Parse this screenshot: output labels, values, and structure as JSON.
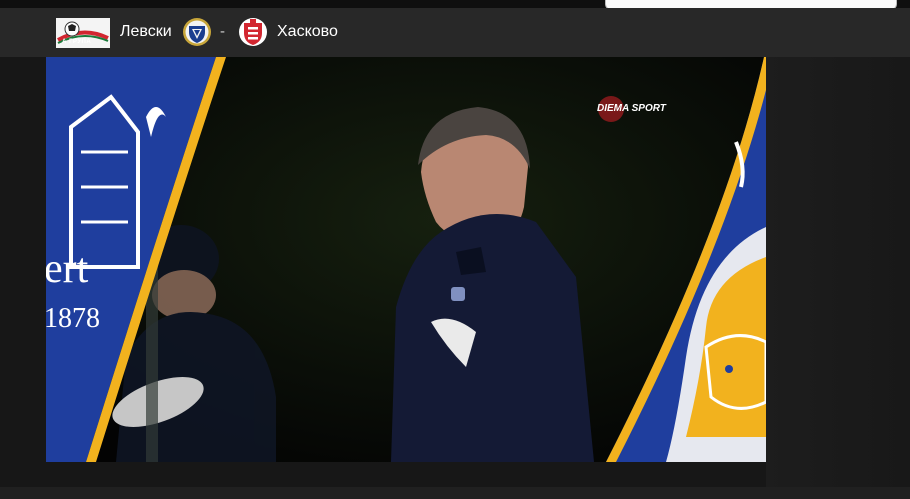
{
  "match": {
    "home_team": "Левски",
    "separator": "-",
    "away_team": "Хасково",
    "league_logo_text": "А ГРУПА"
  },
  "video": {
    "broadcaster_logo": "DIEMA SPORT",
    "left_crest_text": "ert",
    "left_crest_year": "1878"
  },
  "icons": {
    "league": "league-logo-icon",
    "home_crest": "levski-crest-icon",
    "away_crest": "haskovo-crest-icon"
  },
  "colors": {
    "header_bg": "#282828",
    "video_bg": "#050505",
    "everton_blue": "#1f3e9e",
    "leicester_gold": "#f2b21e",
    "levski_blue": "#1a3d8f",
    "haskovo_red": "#d22630"
  }
}
